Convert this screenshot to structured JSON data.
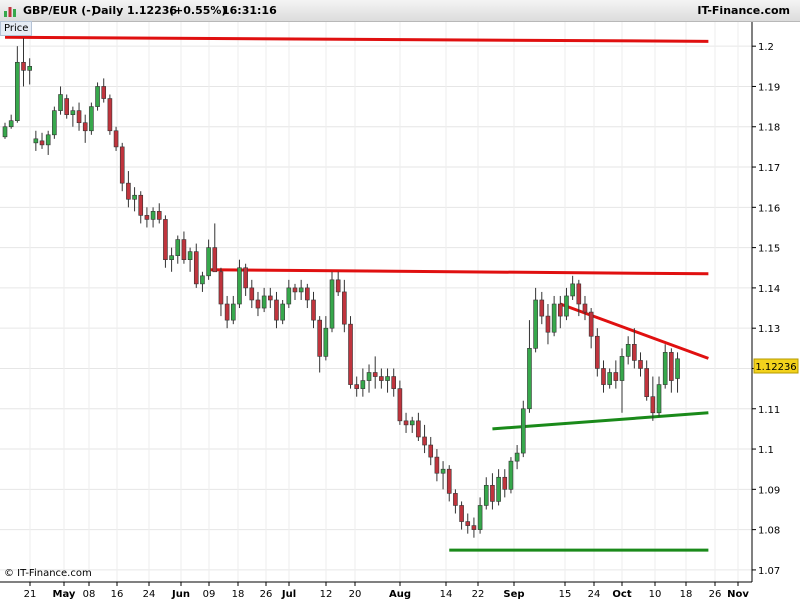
{
  "header": {
    "symbol": "GBP/EUR (-)",
    "period": "Daily",
    "last": "1.12236",
    "change": "(+0.55%)",
    "time": "16:31:16",
    "brand": "IT-Finance.com"
  },
  "price_tag": "Price",
  "copyright": "© IT-Finance.com",
  "colors": {
    "up": "#37a84c",
    "down": "#c0343d",
    "resistance": "#e01010",
    "support": "#1a8a1a",
    "last_badge": "#f3d21c"
  },
  "chart_data": {
    "type": "candlestick",
    "ylim": [
      1.067,
      1.206
    ],
    "y_ticks": [
      "1.2",
      "1.19",
      "1.18",
      "1.17",
      "1.16",
      "1.15",
      "1.14",
      "1.13",
      "1.12",
      "1.11",
      "1.1",
      "1.09",
      "1.08",
      "1.07"
    ],
    "x_ticks": [
      "21",
      "May",
      "08",
      "16",
      "24",
      "Jun",
      "09",
      "18",
      "26",
      "Jul",
      "12",
      "20",
      "Aug",
      "14",
      "22",
      "Sep",
      "15",
      "24",
      "Oct",
      "10",
      "18",
      "26",
      "Nov"
    ],
    "last_price_label": "1.12236",
    "candles": [
      [
        1.1775,
        1.181,
        1.177,
        1.18
      ],
      [
        1.18,
        1.183,
        1.1795,
        1.1815
      ],
      [
        1.1815,
        1.2,
        1.181,
        1.196
      ],
      [
        1.196,
        1.202,
        1.19,
        1.194
      ],
      [
        1.194,
        1.197,
        1.1905,
        1.195
      ],
      [
        1.176,
        1.179,
        1.174,
        1.177
      ],
      [
        1.1765,
        1.1785,
        1.1745,
        1.1755
      ],
      [
        1.1755,
        1.179,
        1.173,
        1.178
      ],
      [
        1.178,
        1.185,
        1.177,
        1.184
      ],
      [
        1.184,
        1.19,
        1.183,
        1.188
      ],
      [
        1.187,
        1.188,
        1.182,
        1.183
      ],
      [
        1.183,
        1.185,
        1.18,
        1.184
      ],
      [
        1.184,
        1.186,
        1.179,
        1.181
      ],
      [
        1.181,
        1.183,
        1.176,
        1.179
      ],
      [
        1.179,
        1.186,
        1.178,
        1.185
      ],
      [
        1.185,
        1.191,
        1.184,
        1.19
      ],
      [
        1.19,
        1.192,
        1.186,
        1.187
      ],
      [
        1.187,
        1.188,
        1.178,
        1.179
      ],
      [
        1.179,
        1.18,
        1.174,
        1.175
      ],
      [
        1.175,
        1.176,
        1.164,
        1.166
      ],
      [
        1.166,
        1.169,
        1.16,
        1.162
      ],
      [
        1.162,
        1.165,
        1.159,
        1.163
      ],
      [
        1.163,
        1.164,
        1.156,
        1.158
      ],
      [
        1.158,
        1.16,
        1.155,
        1.157
      ],
      [
        1.157,
        1.16,
        1.155,
        1.159
      ],
      [
        1.159,
        1.161,
        1.156,
        1.157
      ],
      [
        1.157,
        1.158,
        1.145,
        1.147
      ],
      [
        1.147,
        1.15,
        1.144,
        1.148
      ],
      [
        1.148,
        1.153,
        1.146,
        1.152
      ],
      [
        1.152,
        1.154,
        1.146,
        1.147
      ],
      [
        1.147,
        1.15,
        1.144,
        1.149
      ],
      [
        1.149,
        1.151,
        1.14,
        1.141
      ],
      [
        1.141,
        1.144,
        1.139,
        1.143
      ],
      [
        1.143,
        1.152,
        1.142,
        1.15
      ],
      [
        1.15,
        1.156,
        1.148,
        1.144
      ],
      [
        1.144,
        1.145,
        1.133,
        1.136
      ],
      [
        1.136,
        1.138,
        1.13,
        1.132
      ],
      [
        1.132,
        1.138,
        1.131,
        1.136
      ],
      [
        1.136,
        1.147,
        1.135,
        1.145
      ],
      [
        1.145,
        1.146,
        1.138,
        1.14
      ],
      [
        1.14,
        1.142,
        1.135,
        1.137
      ],
      [
        1.137,
        1.139,
        1.133,
        1.135
      ],
      [
        1.135,
        1.14,
        1.134,
        1.138
      ],
      [
        1.138,
        1.14,
        1.135,
        1.137
      ],
      [
        1.137,
        1.139,
        1.13,
        1.132
      ],
      [
        1.132,
        1.137,
        1.131,
        1.136
      ],
      [
        1.136,
        1.142,
        1.135,
        1.14
      ],
      [
        1.14,
        1.141,
        1.137,
        1.139
      ],
      [
        1.139,
        1.142,
        1.137,
        1.14
      ],
      [
        1.14,
        1.141,
        1.135,
        1.137
      ],
      [
        1.137,
        1.139,
        1.13,
        1.132
      ],
      [
        1.132,
        1.133,
        1.119,
        1.123
      ],
      [
        1.123,
        1.133,
        1.122,
        1.13
      ],
      [
        1.13,
        1.144,
        1.129,
        1.142
      ],
      [
        1.142,
        1.144,
        1.138,
        1.139
      ],
      [
        1.139,
        1.142,
        1.129,
        1.131
      ],
      [
        1.131,
        1.133,
        1.115,
        1.116
      ],
      [
        1.116,
        1.118,
        1.113,
        1.115
      ],
      [
        1.115,
        1.12,
        1.113,
        1.117
      ],
      [
        1.117,
        1.121,
        1.114,
        1.119
      ],
      [
        1.119,
        1.123,
        1.115,
        1.118
      ],
      [
        1.118,
        1.12,
        1.115,
        1.117
      ],
      [
        1.117,
        1.12,
        1.114,
        1.118
      ],
      [
        1.118,
        1.12,
        1.113,
        1.115
      ],
      [
        1.115,
        1.117,
        1.106,
        1.107
      ],
      [
        1.107,
        1.109,
        1.104,
        1.106
      ],
      [
        1.106,
        1.108,
        1.104,
        1.107
      ],
      [
        1.107,
        1.109,
        1.102,
        1.103
      ],
      [
        1.103,
        1.106,
        1.099,
        1.101
      ],
      [
        1.101,
        1.103,
        1.096,
        1.098
      ],
      [
        1.098,
        1.1,
        1.092,
        1.094
      ],
      [
        1.094,
        1.097,
        1.09,
        1.095
      ],
      [
        1.095,
        1.096,
        1.087,
        1.089
      ],
      [
        1.089,
        1.09,
        1.084,
        1.086
      ],
      [
        1.086,
        1.087,
        1.08,
        1.082
      ],
      [
        1.082,
        1.084,
        1.079,
        1.081
      ],
      [
        1.081,
        1.083,
        1.078,
        1.08
      ],
      [
        1.08,
        1.088,
        1.079,
        1.086
      ],
      [
        1.086,
        1.093,
        1.085,
        1.091
      ],
      [
        1.091,
        1.094,
        1.085,
        1.087
      ],
      [
        1.087,
        1.095,
        1.086,
        1.093
      ],
      [
        1.093,
        1.095,
        1.088,
        1.09
      ],
      [
        1.09,
        1.098,
        1.089,
        1.097
      ],
      [
        1.097,
        1.101,
        1.095,
        1.099
      ],
      [
        1.099,
        1.112,
        1.098,
        1.11
      ],
      [
        1.11,
        1.132,
        1.109,
        1.125
      ],
      [
        1.125,
        1.14,
        1.124,
        1.137
      ],
      [
        1.137,
        1.139,
        1.131,
        1.133
      ],
      [
        1.133,
        1.136,
        1.126,
        1.129
      ],
      [
        1.129,
        1.138,
        1.128,
        1.136
      ],
      [
        1.136,
        1.138,
        1.13,
        1.133
      ],
      [
        1.133,
        1.14,
        1.132,
        1.138
      ],
      [
        1.138,
        1.143,
        1.137,
        1.141
      ],
      [
        1.141,
        1.142,
        1.133,
        1.136
      ],
      [
        1.136,
        1.138,
        1.132,
        1.134
      ],
      [
        1.134,
        1.135,
        1.125,
        1.128
      ],
      [
        1.128,
        1.13,
        1.118,
        1.12
      ],
      [
        1.12,
        1.122,
        1.114,
        1.116
      ],
      [
        1.116,
        1.12,
        1.115,
        1.119
      ],
      [
        1.119,
        1.122,
        1.115,
        1.117
      ],
      [
        1.117,
        1.125,
        1.109,
        1.123
      ],
      [
        1.123,
        1.128,
        1.121,
        1.126
      ],
      [
        1.126,
        1.13,
        1.12,
        1.122
      ],
      [
        1.122,
        1.124,
        1.118,
        1.12
      ],
      [
        1.12,
        1.122,
        1.112,
        1.113
      ],
      [
        1.113,
        1.118,
        1.107,
        1.109
      ],
      [
        1.109,
        1.118,
        1.108,
        1.116
      ],
      [
        1.116,
        1.126,
        1.115,
        1.124
      ],
      [
        1.124,
        1.125,
        1.114,
        1.117
      ],
      [
        1.1175,
        1.124,
        1.114,
        1.1224
      ]
    ],
    "trendlines": [
      {
        "color": "resistance",
        "from": [
          0,
          1.2022
        ],
        "to": [
          114,
          1.2012
        ]
      },
      {
        "color": "resistance",
        "from": [
          33,
          1.1445
        ],
        "to": [
          114,
          1.1435
        ]
      },
      {
        "color": "resistance",
        "from": [
          90,
          1.136
        ],
        "to": [
          114,
          1.1225
        ]
      },
      {
        "color": "support",
        "from": [
          79,
          1.105
        ],
        "to": [
          114,
          1.109
        ]
      },
      {
        "color": "support",
        "from": [
          72,
          1.0749
        ],
        "to": [
          114,
          1.0749
        ]
      }
    ]
  }
}
